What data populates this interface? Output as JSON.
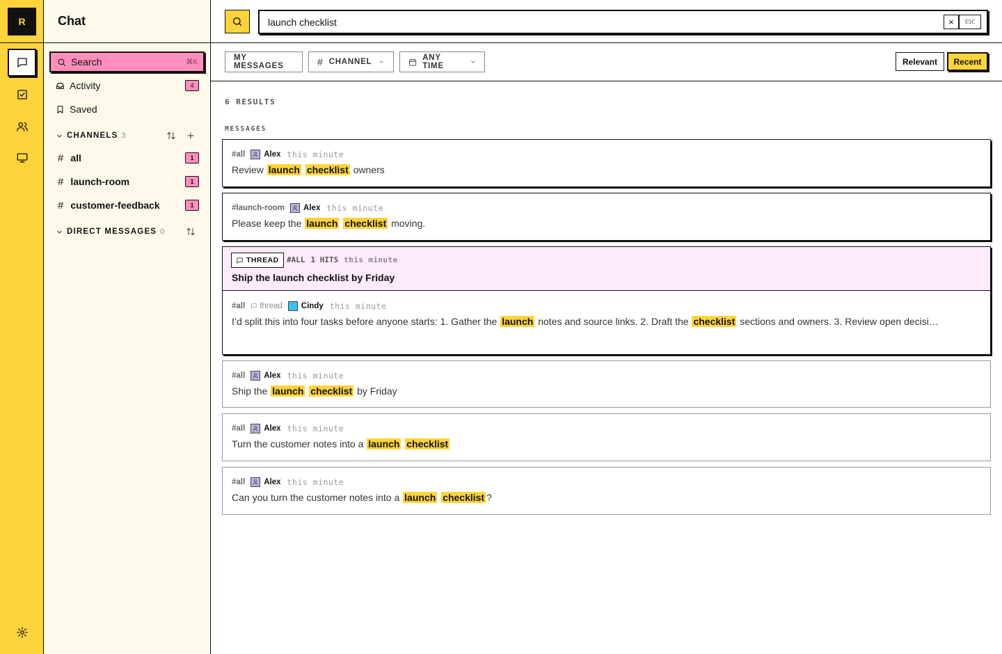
{
  "rail": {
    "logo": "R",
    "icons": [
      "chat-icon",
      "tasks-icon",
      "people-icon",
      "monitor-icon",
      "settings-icon"
    ]
  },
  "sidebar": {
    "title": "Chat",
    "nav": [
      {
        "label": "Search",
        "shortcut": "⌘K",
        "icon": "search-icon",
        "active": true
      },
      {
        "label": "Activity",
        "badge": "4",
        "icon": "inbox-icon"
      },
      {
        "label": "Saved",
        "icon": "bookmark-icon"
      }
    ],
    "channels_header": "CHANNELS",
    "channels_count": "3",
    "channels": [
      {
        "name": "all",
        "badge": "1"
      },
      {
        "name": "launch-room",
        "badge": "1"
      },
      {
        "name": "customer-feedback",
        "badge": "1"
      }
    ],
    "dm_header": "DIRECT MESSAGES",
    "dm_count": "0"
  },
  "search": {
    "query": "launch checklist",
    "clear": "×",
    "esc": "ESC"
  },
  "filters": {
    "my_messages": "MY MESSAGES",
    "channel": "CHANNEL",
    "any_time": "ANY TIME",
    "sort_relevant": "Relevant",
    "sort_recent": "Recent",
    "sort_active": "Recent"
  },
  "results": {
    "count_label": "6 RESULTS",
    "section_label": "MESSAGES",
    "items": [
      {
        "channel": "#all",
        "author": "Alex",
        "time": "this minute",
        "parts": [
          "Review ",
          "[launch]",
          " ",
          "[checklist]",
          " owners"
        ]
      },
      {
        "channel": "#launch-room",
        "author": "Alex",
        "time": "this minute",
        "parts": [
          "Please keep the ",
          "[launch]",
          " ",
          "[checklist]",
          " moving."
        ]
      },
      {
        "channel": "#all",
        "author": "Alex",
        "time": "this minute",
        "parts": [
          "Ship the ",
          "[launch]",
          " ",
          "[checklist]",
          " by Friday"
        ]
      },
      {
        "channel": "#all",
        "author": "Alex",
        "time": "this minute",
        "parts": [
          "Turn the customer notes into a ",
          "[launch]",
          " ",
          "[checklist]"
        ]
      },
      {
        "channel": "#all",
        "author": "Alex",
        "time": "this minute",
        "parts": [
          "Can you turn the customer notes into a ",
          "[launch]",
          " ",
          "[checklist]",
          "?"
        ]
      }
    ],
    "thread": {
      "tag": "THREAD",
      "channel": "#ALL",
      "hits": "1 HITS",
      "time": "this minute",
      "title": "Ship the launch checklist by Friday",
      "reply": {
        "channel": "#all",
        "thread_label": "thread",
        "author": "Cindy",
        "time": "this minute",
        "parts": [
          "I’d split this into four tasks before anyone starts: 1. Gather the ",
          "[launch]",
          " notes and source links. 2. Draft the ",
          "[checklist]",
          " sections and owners. 3. Review open decisi…"
        ]
      }
    }
  },
  "colors": {
    "accent": "#FFD43B",
    "pink": "#FF8EBC",
    "thread_bg": "#FDEBFB",
    "sidebar_bg": "#FFF9EB"
  }
}
